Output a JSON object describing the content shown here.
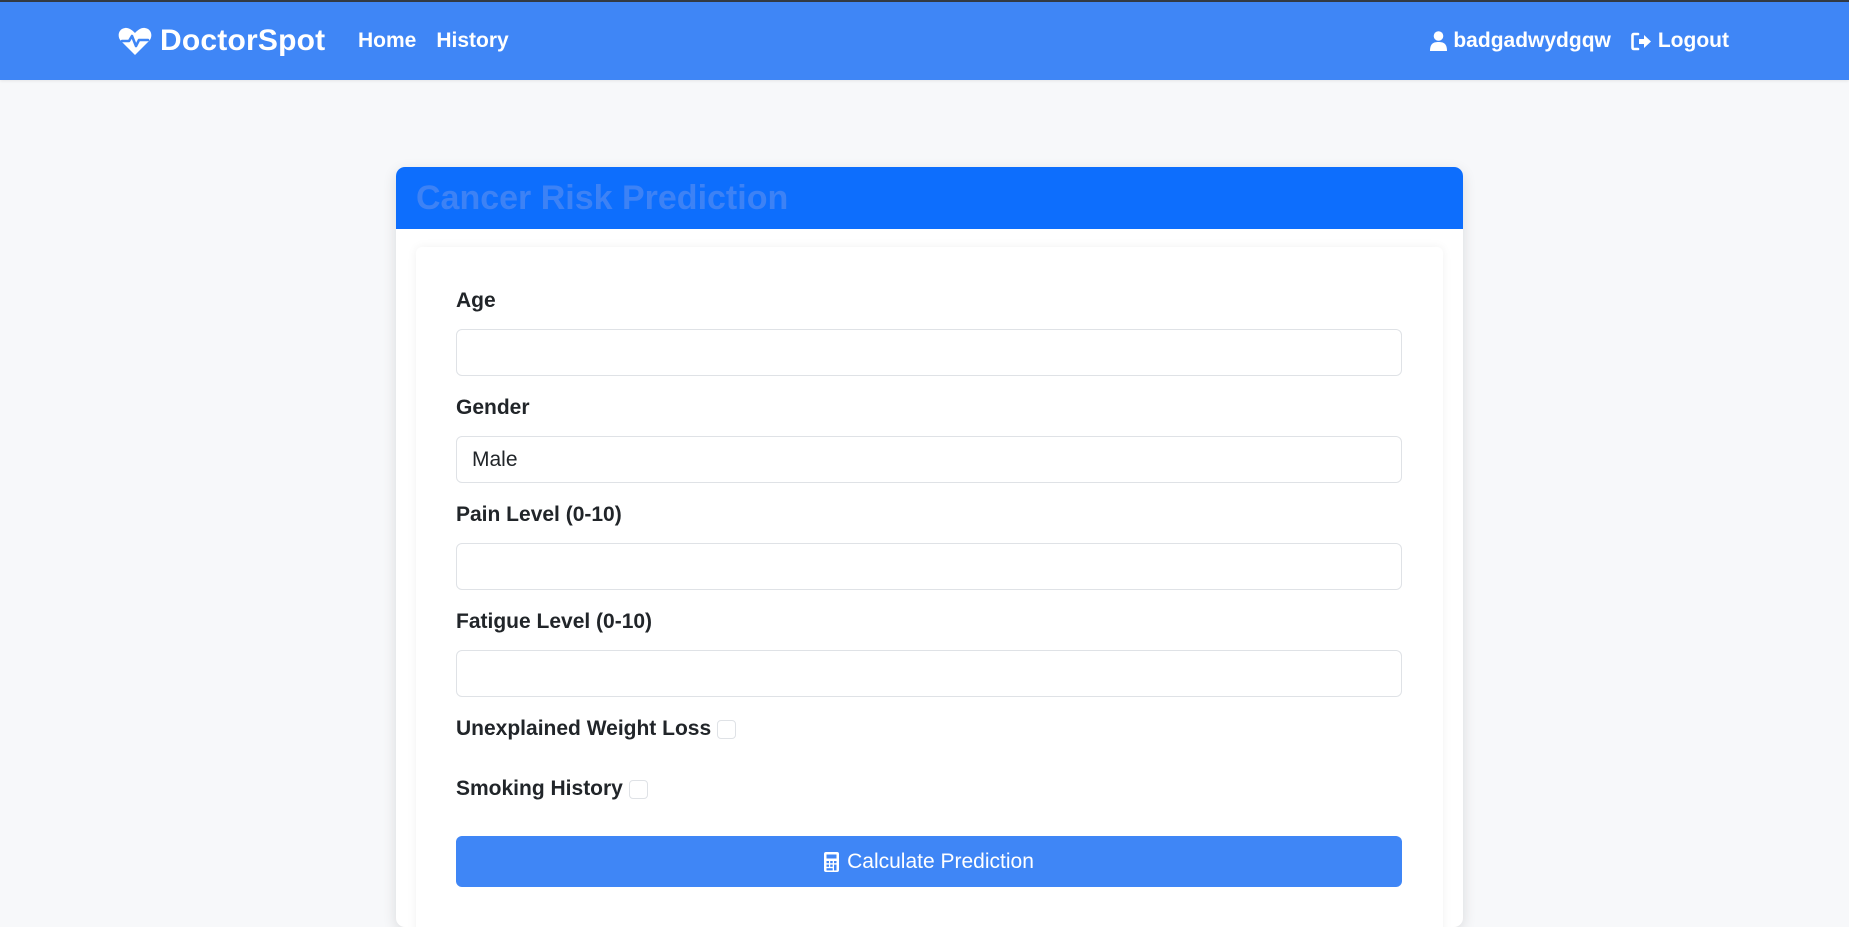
{
  "navbar": {
    "brand": "DoctorSpot",
    "brand_icon": "heart-pulse-icon",
    "links": [
      "Home",
      "History"
    ],
    "username": "badgadwydgqw",
    "user_icon": "user-icon",
    "logout": "Logout",
    "logout_icon": "sign-out-icon",
    "background": "#3f86f6"
  },
  "card": {
    "title": "Cancer Risk Prediction",
    "header_color": "#0d6efd"
  },
  "form": {
    "age_label": "Age",
    "age_value": "",
    "gender_label": "Gender",
    "gender_value": "Male",
    "pain_label": "Pain Level (0-10)",
    "pain_value": "",
    "fatigue_label": "Fatigue Level (0-10)",
    "fatigue_value": "",
    "weight_loss_label": "Unexplained Weight Loss",
    "weight_loss_checked": false,
    "smoking_label": "Smoking History",
    "smoking_checked": false,
    "submit_label": "Calculate Prediction",
    "submit_icon": "calculator-icon"
  }
}
